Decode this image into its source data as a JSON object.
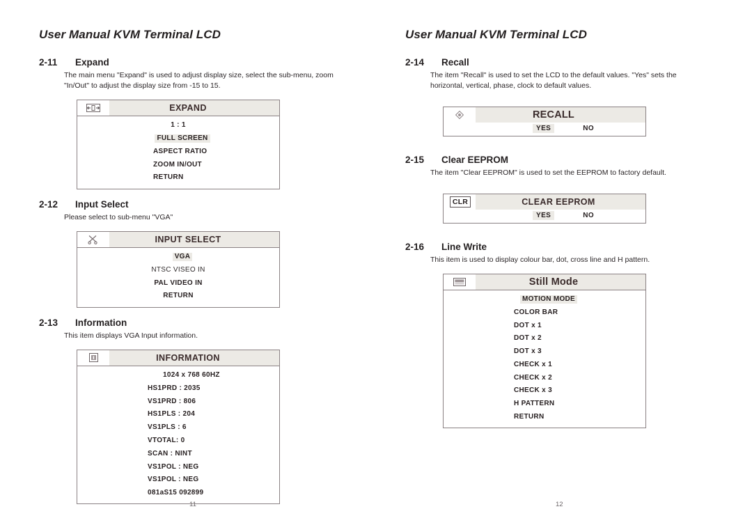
{
  "document": {
    "running_head": "User Manual KVM Terminal LCD",
    "page_left": "11",
    "page_right": "12"
  },
  "left_column": {
    "sections": [
      {
        "number": "2-11",
        "title": "Expand",
        "body": "The main menu \"Expand\" is used to adjust display size, select the sub-menu, zoom  \"In/Out\" to adjust the display size from  -15 to 15.",
        "osd": {
          "icon": "expand-arrows-icon",
          "title": "EXPAND",
          "items": [
            {
              "label": "1 : 1",
              "highlight": false
            },
            {
              "label": "FULL SCREEN",
              "highlight": true
            },
            {
              "label": "ASPECT RATIO",
              "highlight": false
            },
            {
              "label": "ZOOM  IN/OUT",
              "highlight": false
            },
            {
              "label": "RETURN",
              "highlight": false
            }
          ]
        }
      },
      {
        "number": "2-12",
        "title": "Input Select",
        "body": "Please select to sub-menu \"VGA\"",
        "osd": {
          "icon": "scissors-icon",
          "title": "INPUT SELECT",
          "items": [
            {
              "label": "VGA",
              "highlight": true
            },
            {
              "label": "NTSC VISEO IN",
              "highlight": false,
              "light": true
            },
            {
              "label": "PAL VIDEO IN",
              "highlight": false
            },
            {
              "label": "RETURN",
              "highlight": false
            }
          ]
        }
      },
      {
        "number": "2-13",
        "title": "Information",
        "body": "This item displays VGA Input information.",
        "osd": {
          "icon": "information-icon",
          "title": "INFORMATION",
          "items": [
            {
              "label": "1024 x 768 60HZ",
              "highlight": false
            },
            {
              "label": "HS1PRD : 2035",
              "highlight": false
            },
            {
              "label": "VS1PRD : 806",
              "highlight": false
            },
            {
              "label": "HS1PLS  : 204",
              "highlight": false
            },
            {
              "label": "VS1PLS  : 6",
              "highlight": false
            },
            {
              "label": "VTOTAL: 0",
              "highlight": false
            },
            {
              "label": "SCAN    : NINT",
              "highlight": false
            },
            {
              "label": "VS1POL : NEG",
              "highlight": false
            },
            {
              "label": "VS1POL : NEG",
              "highlight": false
            },
            {
              "label": "081aS15  092899",
              "highlight": false
            }
          ]
        }
      }
    ]
  },
  "right_column": {
    "sections": [
      {
        "number": "2-14",
        "title": "Recall",
        "body": "The item \"Recall\" is used to set the LCD to the default values.  \"Yes\" sets the horizontal, vertical, phase, clock to default values.",
        "osd": {
          "icon": "recall-diamond-icon",
          "title": "RECALL",
          "yes_label": "YES",
          "no_label": "NO"
        }
      },
      {
        "number": "2-15",
        "title": "Clear EEPROM",
        "body": "The item \"Clear EEPROM\" is used to set the EEPROM to factory default.",
        "osd": {
          "icon": "clr-icon",
          "icon_label": "CLR",
          "title": "CLEAR  EEPROM",
          "yes_label": "YES",
          "no_label": "NO"
        }
      },
      {
        "number": "2-16",
        "title": "Line Write",
        "body": "This item is used to display colour bar, dot, cross line and H pattern.",
        "osd": {
          "icon": "display-rect-icon",
          "title": "Still  Mode",
          "items": [
            {
              "label": "MOTION  MODE",
              "highlight": true
            },
            {
              "label": "COLOR BAR",
              "highlight": false
            },
            {
              "label": "DOT  x   1",
              "highlight": false
            },
            {
              "label": "DOT  x   2",
              "highlight": false
            },
            {
              "label": "DOT  x   3",
              "highlight": false
            },
            {
              "label": "CHECK  x   1",
              "highlight": false
            },
            {
              "label": "CHECK  x   2",
              "highlight": false
            },
            {
              "label": "CHECK  x   3",
              "highlight": false
            },
            {
              "label": "H  PATTERN",
              "highlight": false
            },
            {
              "label": "RETURN",
              "highlight": false
            }
          ]
        }
      }
    ]
  },
  "colors": {
    "text": "#231f20",
    "highlight_bg": "#eceae5",
    "box_border": "#8a8183"
  }
}
